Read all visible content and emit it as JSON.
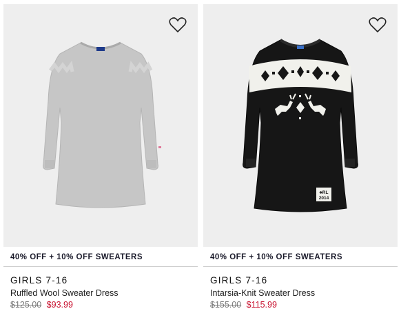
{
  "products": [
    {
      "promo": "40% OFF + 10% OFF SWEATERS",
      "category": "GIRLS 7-16",
      "name": "Ruffled Wool Sweater Dress",
      "original_price": "$125.00",
      "sale_price": "$93.99",
      "wishlist_icon": "heart-outline-icon",
      "image_color": "#c8c8c8"
    },
    {
      "promo": "40% OFF + 10% OFF SWEATERS",
      "category": "GIRLS 7-16",
      "name": "Intarsia-Knit Sweater Dress",
      "original_price": "$155.00",
      "sale_price": "$115.99",
      "wishlist_icon": "heart-outline-icon",
      "image_color": "#141414",
      "patch_text_line1": "♣RL",
      "patch_text_line2": "2014"
    }
  ],
  "colors": {
    "sale_price": "#c8102e",
    "original_price": "#7a7a7a",
    "image_background": "#eeeeee"
  }
}
